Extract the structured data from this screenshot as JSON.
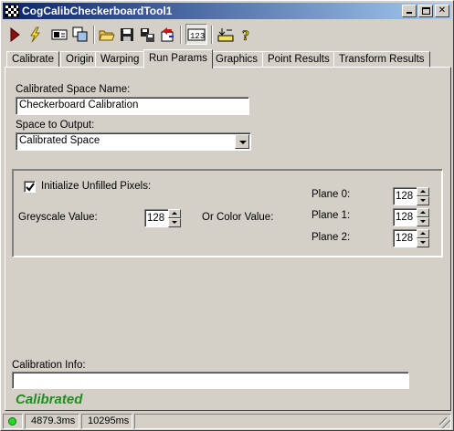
{
  "window": {
    "title": "CogCalibCheckerboardTool1"
  },
  "toolbar": {
    "buttons": [
      "run-icon",
      "electric-run-icon",
      "show-image-icon",
      "local-graphics-icon",
      "open-icon",
      "save-icon",
      "save-settings-icon",
      "reset-icon",
      "result-grid-icon",
      "floating-display-icon",
      "help-icon"
    ]
  },
  "tabs": [
    {
      "label": "Calibrate"
    },
    {
      "label": "Origin"
    },
    {
      "label": "Warping"
    },
    {
      "label": "Run Params",
      "active": true
    },
    {
      "label": "Graphics"
    },
    {
      "label": "Point Results"
    },
    {
      "label": "Transform Results"
    }
  ],
  "run_params": {
    "calibrated_space_label": "Calibrated Space Name:",
    "calibrated_space_value": "Checkerboard Calibration",
    "space_output_label": "Space to Output:",
    "space_output_value": "Calibrated Space",
    "init_unfilled_label": "Initialize Unfilled Pixels:",
    "init_unfilled_checked": true,
    "greyscale_label": "Greyscale Value:",
    "greyscale_value": "128",
    "color_label": "Or Color Value:",
    "plane0_label": "Plane 0:",
    "plane0_value": "128",
    "plane1_label": "Plane 1:",
    "plane1_value": "128",
    "plane2_label": "Plane 2:",
    "plane2_value": "128",
    "calib_info_label": "Calibration Info:",
    "calib_info_value": "",
    "status": "Calibrated"
  },
  "statusbar": {
    "total_time": "4879.3ms",
    "run_time": "10295ms"
  },
  "colors": {
    "title_start": "#0a246a",
    "title_end": "#a6caf0",
    "status_green": "#1f8f1f",
    "led_green": "#22dd22"
  }
}
